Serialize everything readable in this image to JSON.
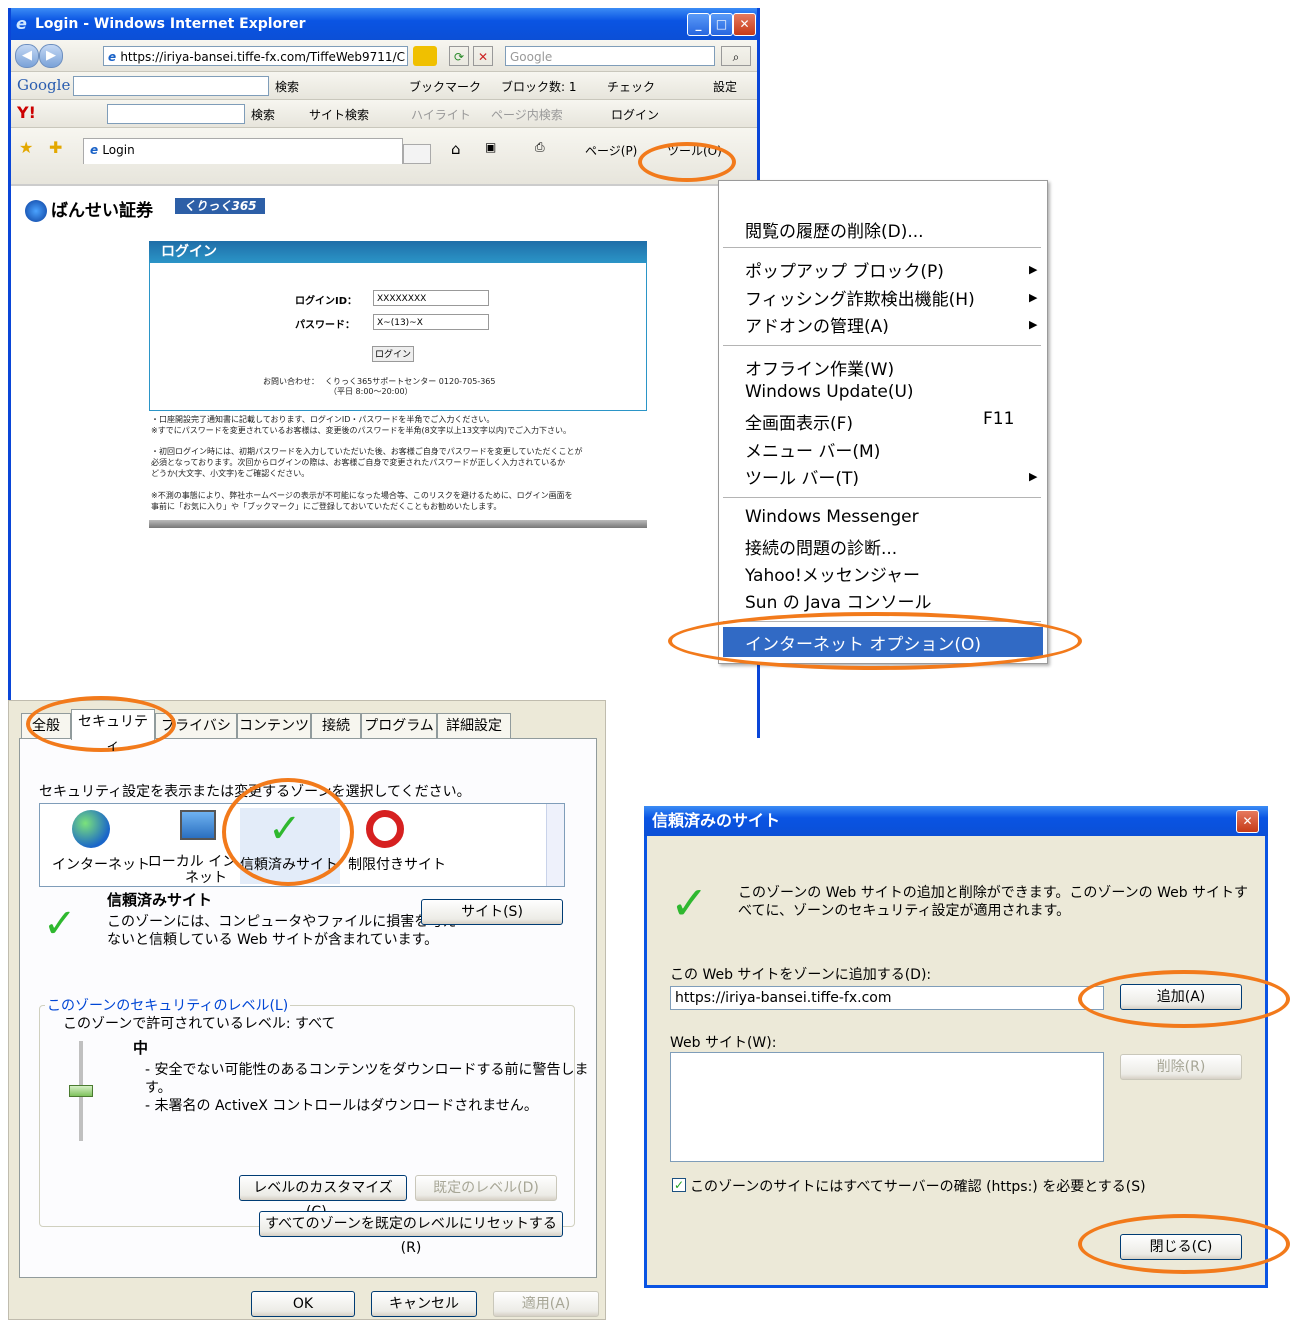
{
  "browser": {
    "title": "Login - Windows Internet Explorer",
    "url": "https://iriya-bansei.tiffe-fx.com/TiffeWeb9711/C",
    "search_placeholder": "Google",
    "google_label": "Google",
    "google_search": "検索",
    "bookmarks": "ブックマーク",
    "blocked": "ブロック数: 1",
    "check": "チェック",
    "settings": "設定",
    "yahoo_search": "検索",
    "site_search": "サイト検索",
    "highlight": "ハイライト",
    "page_search": "ページ内検索",
    "login": "ログイン",
    "tab_label": "Login",
    "page_menu": "ページ(P)",
    "tools_menu": "ツール(O)"
  },
  "page": {
    "brand": "ばんせい証券",
    "brand_badge": "くりっく365",
    "login_heading": "ログイン",
    "login_id_label": "ログインID：",
    "login_id_value": "XXXXXXXX",
    "password_label": "パスワード：",
    "password_value": "X~(13)~X",
    "login_button": "ログイン",
    "contact_label": "お問い合わせ：",
    "contact_value": "くりっく365サポートセンター 0120-705-365",
    "contact_hours": "（平日 8:00～20:00）",
    "note1": "・口座開設完了通知書に記載しております、ログインID・パスワードを半角でご入力ください。",
    "note2": "※すでにパスワードを変更されているお客様は、変更後のパスワードを半角(8文字以上13文字以内)でご入力下さい。",
    "note3": "・初回ログイン時には、初期パスワードを入力していただいた後、お客様ご自身でパスワードを変更していただくことが",
    "note4": "必須となっております。次回からログインの際は、お客様ご自身で変更されたパスワードが正しく入力されているか",
    "note5": "どうか(大文字、小文字)をご確認ください。",
    "note6": "※不測の事態により、弊社ホームページの表示が不可能になった場合等、このリスクを避けるために、ログイン画面を",
    "note7": "事前に「お気に入り」や「ブックマーク」にご登録しておいていただくこともお勧めいたします。"
  },
  "menu": {
    "items": [
      "閲覧の履歴の削除(D)...",
      "ポップアップ ブロック(P)",
      "フィッシング詐欺検出機能(H)",
      "アドオンの管理(A)",
      "オフライン作業(W)",
      "Windows Update(U)",
      "全画面表示(F)",
      "メニュー バー(M)",
      "ツール バー(T)",
      "Windows Messenger",
      "接続の問題の診断...",
      "Yahoo!メッセンジャー",
      "Sun の Java コンソール",
      "インターネット オプション(O)"
    ],
    "fullscreen_shortcut": "F11"
  },
  "options": {
    "tabs": [
      "全般",
      "セキュリティ",
      "プライバシー",
      "コンテンツ",
      "接続",
      "プログラム",
      "詳細設定"
    ],
    "zone_prompt": "セキュリティ設定を表示または変更するゾーンを選択してください。",
    "zones": [
      "インターネット",
      "ローカル イントラネット",
      "信頼済みサイト",
      "制限付きサイト"
    ],
    "zone_title": "信頼済みサイト",
    "zone_desc1": "このゾーンには、コンピュータやファイルに損害を与え",
    "zone_desc2": "ないと信頼している Web サイトが含まれています。",
    "sites_button": "サイト(S)",
    "level_group": "このゾーンのセキュリティのレベル(L)",
    "allowed_levels": "このゾーンで許可されているレベル: すべて",
    "level_name": "中",
    "level_desc1": "- 安全でない可能性のあるコンテンツをダウンロードする前に警告しま",
    "level_desc2": "す。",
    "level_desc3": "- 未署名の ActiveX コントロールはダウンロードされません。",
    "custom_level": "レベルのカスタマイズ(C)...",
    "default_level": "既定のレベル(D)",
    "reset_all": "すべてのゾーンを既定のレベルにリセットする(R)",
    "ok": "OK",
    "cancel": "キャンセル",
    "apply": "適用(A)"
  },
  "trusted": {
    "title": "信頼済みのサイト",
    "desc1": "このゾーンの Web サイトの追加と削除ができます。このゾーンの Web サイトす",
    "desc2": "べてに、ゾーンのセキュリティ設定が適用されます。",
    "add_label": "この Web サイトをゾーンに追加する(D):",
    "add_value": "https://iriya-bansei.tiffe-fx.com",
    "add_button": "追加(A)",
    "sites_label": "Web サイト(W):",
    "remove_button": "削除(R)",
    "require_https": "このゾーンのサイトにはすべてサーバーの確認 (https:) を必要とする(S)",
    "close_button": "閉じる(C)"
  },
  "colors": {
    "accent_ring": "#f27a1b",
    "xp_blue": "#0a54e3",
    "menu_highlight": "#316ac5"
  }
}
